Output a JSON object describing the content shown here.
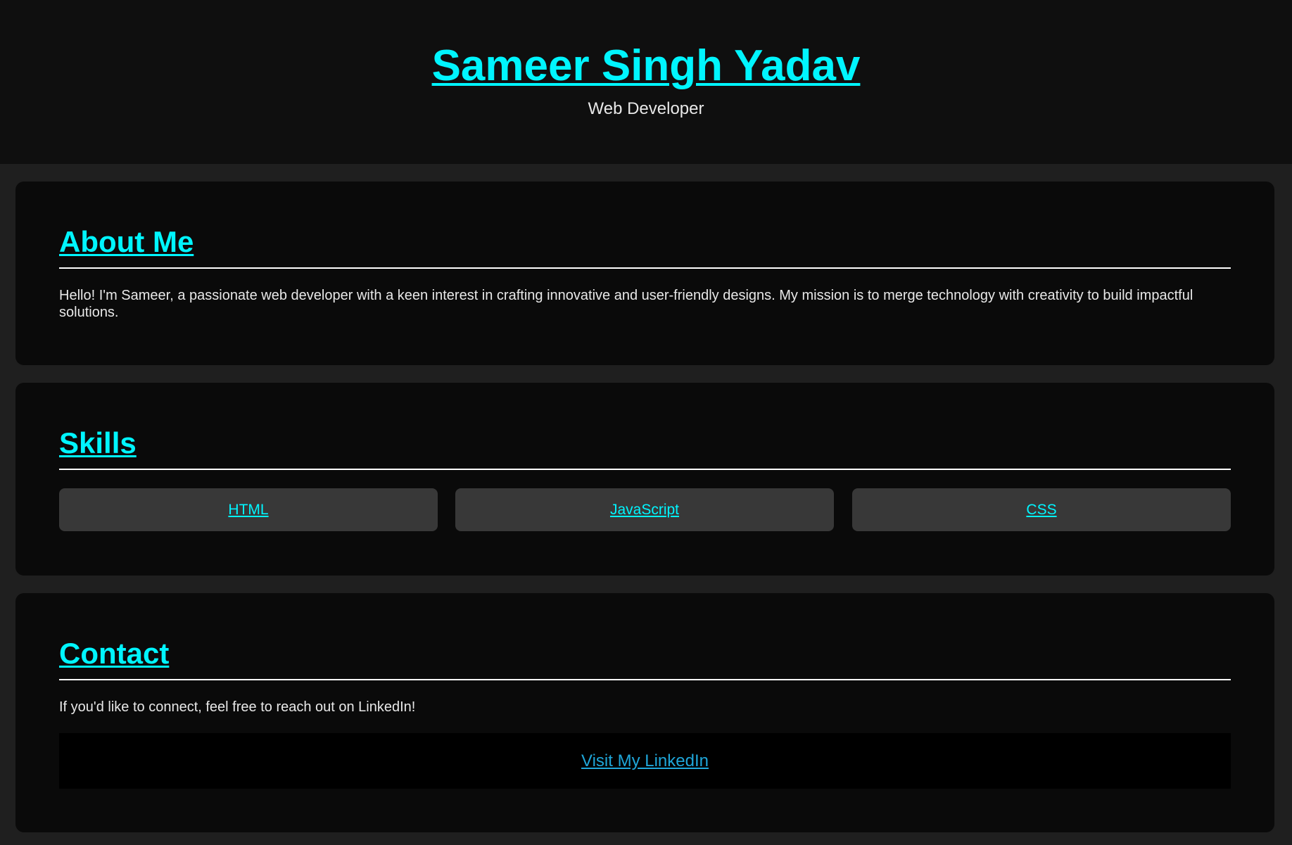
{
  "header": {
    "name": "Sameer Singh Yadav",
    "subtitle": "Web Developer"
  },
  "about": {
    "title": "About Me",
    "text": "Hello! I'm Sameer, a passionate web developer with a keen interest in crafting innovative and user-friendly designs. My mission is to merge technology with creativity to build impactful solutions."
  },
  "skills": {
    "title": "Skills",
    "items": [
      {
        "label": "HTML"
      },
      {
        "label": "JavaScript"
      },
      {
        "label": "CSS"
      }
    ]
  },
  "contact": {
    "title": "Contact",
    "text": "If you'd like to connect, feel free to reach out on LinkedIn!",
    "link_label": "Visit My LinkedIn"
  },
  "colors": {
    "accent": "#00f5ff",
    "link": "#1fa6d9",
    "page_bg": "#1f1f1f",
    "header_bg": "#0f0f0f",
    "card_bg": "#0a0a0a",
    "skill_bg": "#383838"
  }
}
